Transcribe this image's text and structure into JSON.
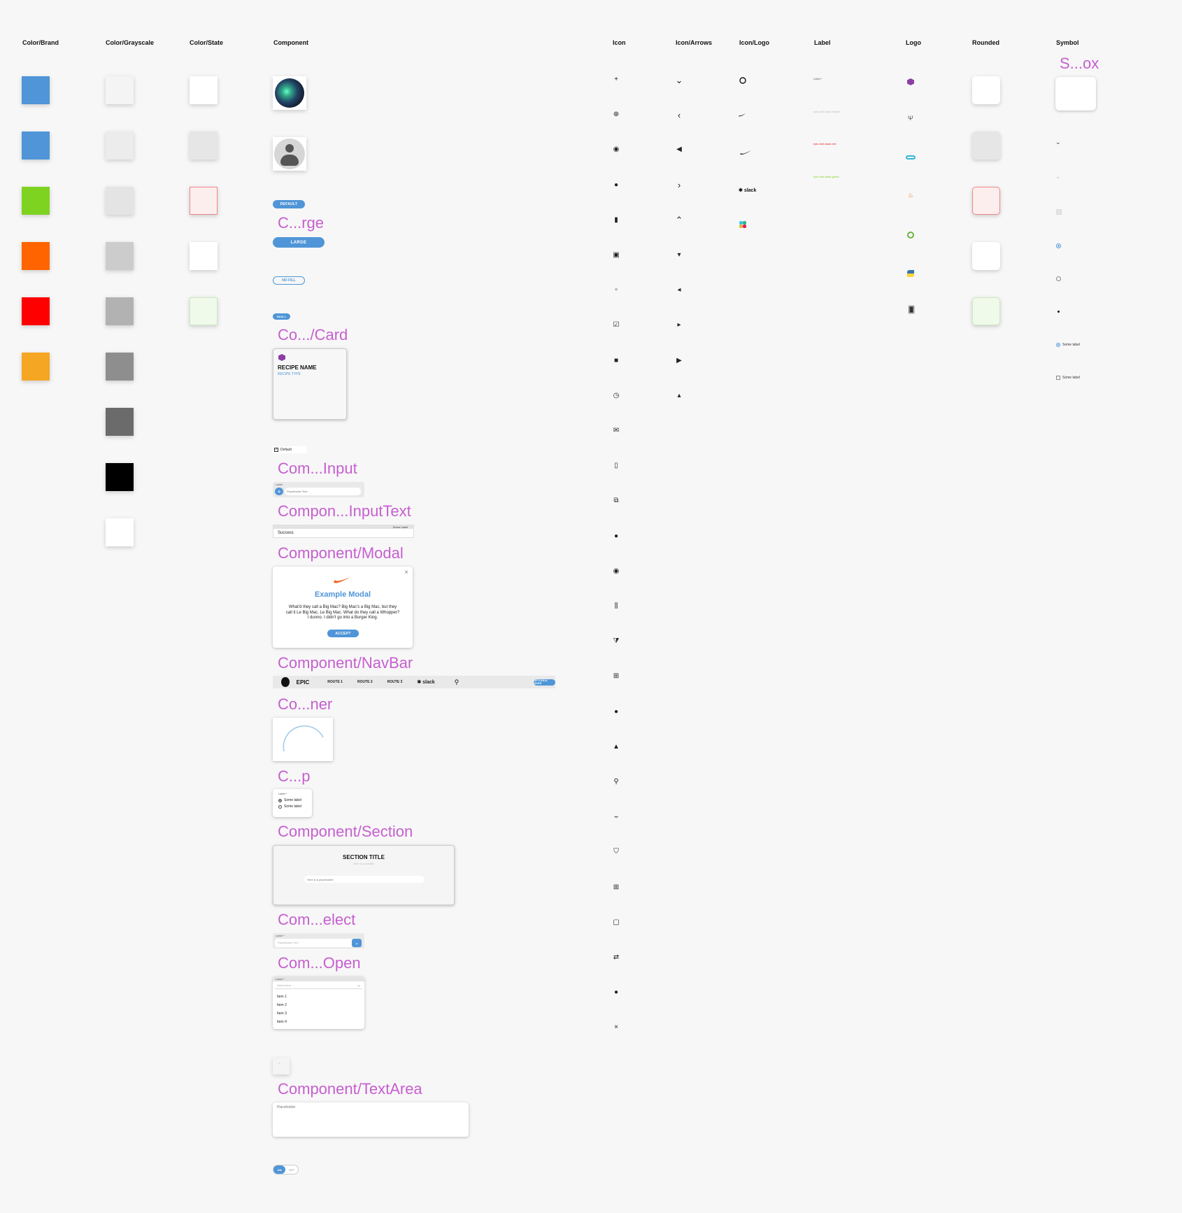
{
  "columns": {
    "brand": "Color/Brand",
    "grayscale": "Color/Grayscale",
    "state": "Color/State",
    "component": "Component",
    "icon": "Icon",
    "arrows": "Icon/Arrows",
    "logo_icons": "Icon/Logo",
    "label": "Label",
    "logo": "Logo",
    "rounded": "Rounded",
    "symbol": "Symbol"
  },
  "colors": {
    "brand": [
      "#4f95d8",
      "#4f95d8",
      "#7ed321",
      "#ff6400",
      "#ff0000",
      "#f5a623"
    ],
    "grayscale": [
      "#f4f4f4",
      "#ececec",
      "#e4e4e4",
      "#cccccc",
      "#b2b2b2",
      "#8e8e8e",
      "#6b6b6b",
      "#000000",
      "#ffffff"
    ],
    "state": [
      "#ffffff",
      "#e6e6e6",
      "#fdeeee",
      "#ffffff",
      "#effaea"
    ],
    "accent_title": "#c65fd0"
  },
  "component": {
    "button_default": "DEFAULT",
    "button_large_title": "C...rge",
    "button_large": "LARGE",
    "button_nofill": "NO FILL",
    "button_small": "SMALL",
    "card_title": "Co.../Card",
    "card_name": "RECIPE NAME",
    "card_type": "RECIPE TYPE",
    "checkbox_label": "Default",
    "input_title": "Com...Input",
    "input_label": "Label",
    "input_placeholder": "Placeholder Text",
    "inputtext_title": "Compon...InputText",
    "inputtext_label": "Some Label",
    "inputtext_value": "Success",
    "modal_title": "Component/Modal",
    "modal_heading": "Example Modal",
    "modal_body": "What'd they call a Big Mac? Big Mac's a Big Mac, but they call it Le Big Mac. Le Big Mac. What do they call a Whopper? I dunno. I didn't go into a Burger King.",
    "modal_button": "ACCEPT",
    "navbar_title": "Component/NavBar",
    "navbar_brand": "EPIC",
    "navbar_routes": [
      "ROUTE 1",
      "ROUTE 2",
      "ROUTE 3"
    ],
    "navbar_slack": "slack",
    "navbar_button": "OPTIONAL NODE",
    "spinner_title": "Co...ner",
    "radiogroup_title": "C...p",
    "radiogroup_label": "Label *",
    "radiogroup_options": [
      "Some label",
      "Some label"
    ],
    "section_title": "Component/Section",
    "section_heading": "SECTION TITLE",
    "section_subtitle": "Here is a subtitle",
    "section_placeholder": "Here is a placeholder",
    "select_title": "Com...elect",
    "select_label": "Label *",
    "select_placeholder": "Placeholder Text",
    "selectopen_title": "Com...Open",
    "selectopen_label": "Label *",
    "selectopen_placeholder": "Select Item",
    "selectopen_items": [
      "Item 1",
      "Item 2",
      "Item 3",
      "Item 4"
    ],
    "textarea_title": "Component/TextArea",
    "textarea_placeholder": "Placeholder",
    "toggle_on": "ON",
    "toggle_off": "OFF"
  },
  "label_samples": [
    "Label *",
    "epic-font-base-shade",
    "epic-font-base-red",
    "epic-font-base-green"
  ],
  "label_colors": [
    "#888888",
    "#bbbbbb",
    "#e02020",
    "#7ed321"
  ],
  "rounded_colors": [
    "#ffffff",
    "#e6e6e6",
    "#fdeeee",
    "#ffffff",
    "#effaea"
  ],
  "symbol": {
    "title": "S...ox",
    "radio_label_1": "Some label",
    "radio_label_2": "Some label"
  },
  "icons": [
    "plus-icon",
    "plus-circle-icon",
    "user-circle-icon",
    "user-icon",
    "bookmark-icon",
    "calendar-icon",
    "square-icon",
    "checkbox-icon",
    "stop-icon",
    "clock-icon",
    "mail-icon",
    "trash-icon",
    "external-link-icon",
    "info-icon",
    "eye-icon",
    "sliders-icon",
    "filter-icon",
    "grid-icon",
    "alert-icon",
    "lock-icon",
    "search-icon",
    "swoosh-icon",
    "shield-icon",
    "plus-square-icon",
    "clipboard-icon",
    "transfer-icon",
    "dot-icon",
    "close-icon"
  ],
  "arrow_icons": [
    "chevron-down-icon",
    "chevron-left-icon",
    "back-circle-icon",
    "chevron-right-icon",
    "chevron-up-icon",
    "caret-down-icon",
    "caret-left-icon",
    "caret-right-icon",
    "forward-circle-icon",
    "caret-up-icon"
  ],
  "logo_icon_slack_text": "slack"
}
